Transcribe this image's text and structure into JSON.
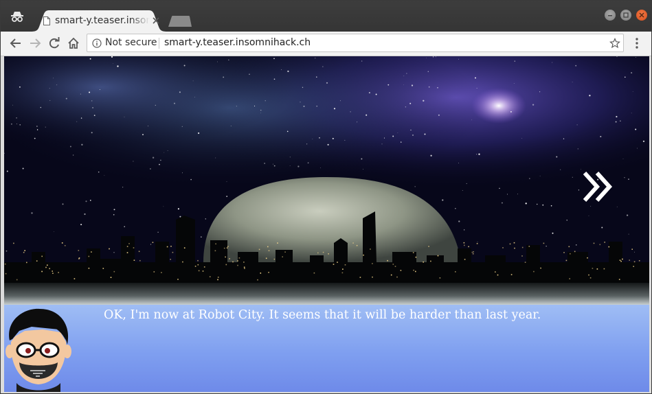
{
  "browser": {
    "tab": {
      "title": "smart-y.teaser.insomnihack.ch",
      "favicon": "page-icon",
      "close_icon": "close-icon"
    },
    "incognito_icon": "incognito-icon",
    "window_controls": [
      "minimize-icon",
      "maximize-icon",
      "close-icon"
    ],
    "nav": [
      "back-arrow-icon",
      "forward-arrow-icon",
      "reload-icon",
      "home-icon"
    ],
    "omnibox": {
      "security_label": "Not secure",
      "url": "smart-y.teaser.insomnihack.ch",
      "info_icon": "info-icon",
      "bookmark_icon": "star-icon"
    },
    "menu_icon": "vertical-dots-icon"
  },
  "game": {
    "scene": "night city skyline with large moon under starry nebula sky",
    "next_icon": "double-chevron-right-icon",
    "dialog": {
      "speaker_icon": "character-portrait",
      "text": "OK, I'm now at Robot City. It seems that it will be harder than last year."
    }
  },
  "colors": {
    "dialog_top": "#9fbdf4",
    "dialog_bottom": "#6e8ae9",
    "close_button": "#e35d2a"
  }
}
